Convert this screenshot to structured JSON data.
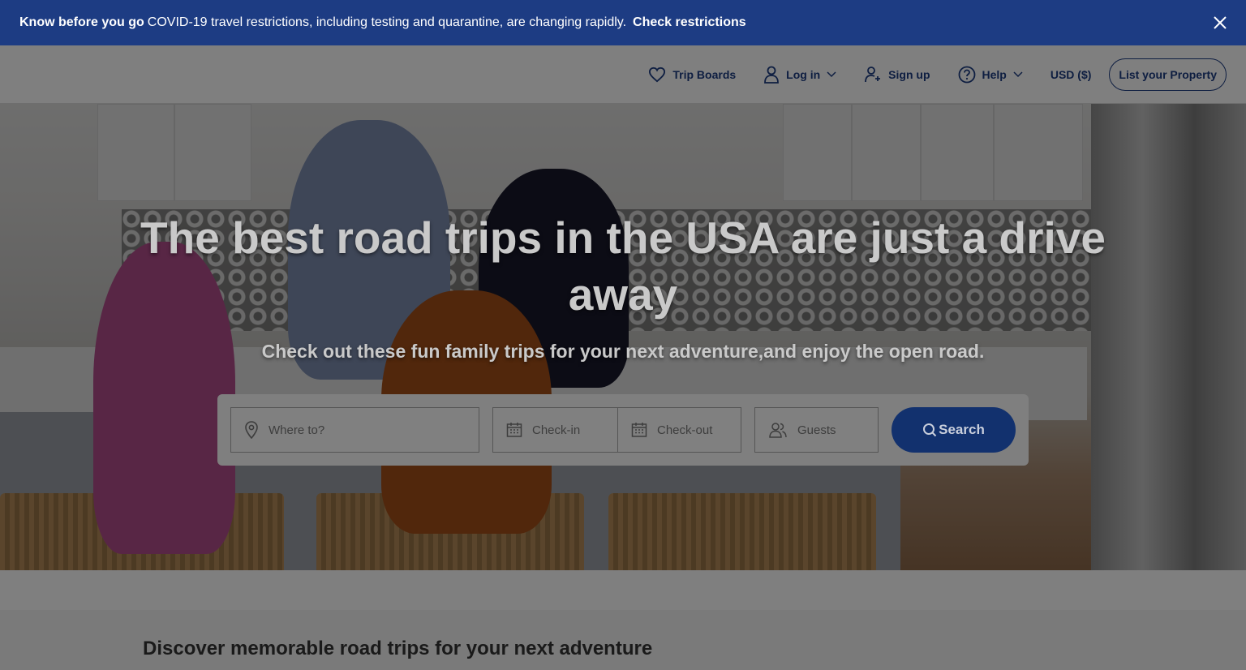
{
  "banner": {
    "strong": "Know before you go",
    "text": "COVID-19 travel restrictions, including testing and quarantine, are changing rapidly.",
    "cta": "Check restrictions"
  },
  "nav": {
    "trip_boards": "Trip Boards",
    "login": "Log in",
    "signup": "Sign up",
    "help": "Help",
    "currency": "USD ($)",
    "list_property": "List your Property"
  },
  "hero": {
    "title": "The best road trips in the USA are just a drive away",
    "subtitle": "Check out these fun family trips for your next adventure,and enjoy the open road."
  },
  "search": {
    "where_placeholder": "Where to?",
    "checkin_placeholder": "Check-in",
    "checkout_placeholder": "Check-out",
    "guests_placeholder": "Guests",
    "button_label": "Search"
  },
  "section": {
    "heading": "Discover memorable road trips for your next adventure"
  },
  "colors": {
    "brand_navy": "#1d3c83",
    "search_button": "#12316e"
  }
}
